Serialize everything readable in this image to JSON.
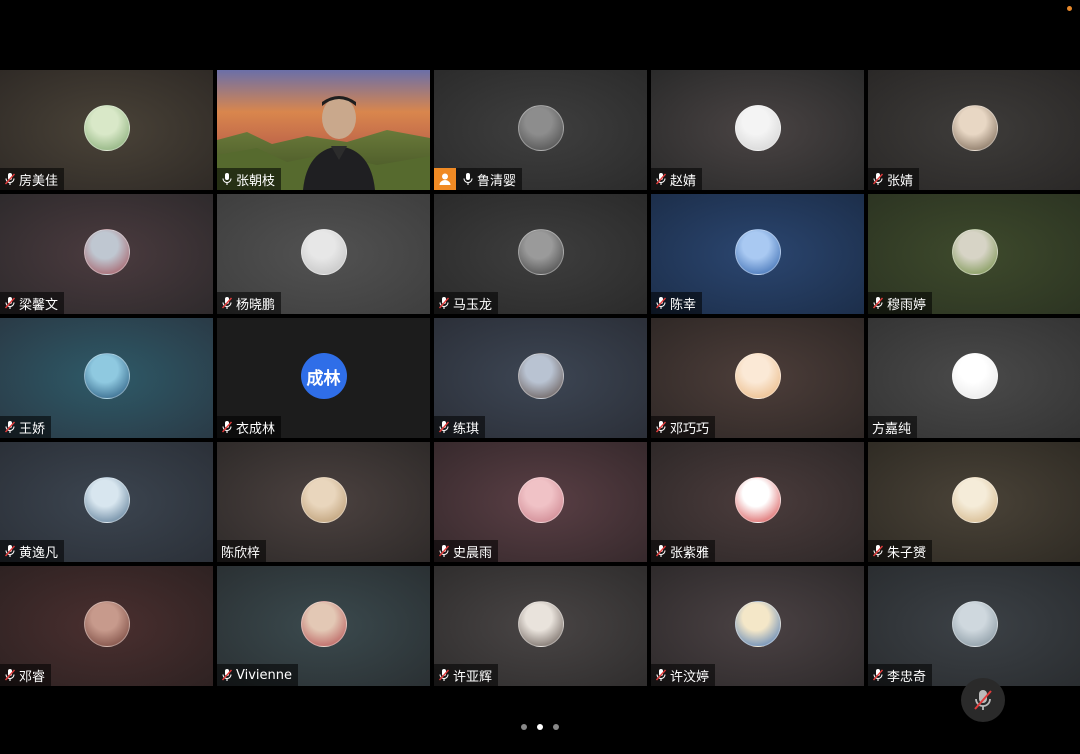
{
  "participants": [
    {
      "name": "房美佳",
      "mic": "muted",
      "bg": [
        "#4a4338",
        "#2f2a26"
      ],
      "avatar": [
        "#d9e8c8",
        "#7aa36a"
      ],
      "kind": "img"
    },
    {
      "name": "张朝枝",
      "mic": "on",
      "kind": "video"
    },
    {
      "name": "鲁清婴",
      "mic": "on",
      "host": true,
      "bg": [
        "#3f3f3f",
        "#2b2b2b"
      ],
      "avatar": [
        "#8d8d8d",
        "#444"
      ],
      "kind": "img"
    },
    {
      "name": "赵婧",
      "mic": "muted",
      "bg": [
        "#4a4444",
        "#2a2a2a"
      ],
      "avatar": [
        "#f4f4f4",
        "#cfcfcf"
      ],
      "kind": "img"
    },
    {
      "name": "张婧",
      "mic": "muted",
      "bg": [
        "#3e3c3a",
        "#2a2827"
      ],
      "avatar": [
        "#e8d7c4",
        "#6d5a48"
      ],
      "kind": "img"
    },
    {
      "name": "梁馨文",
      "mic": "muted",
      "bg": [
        "#4b3b3f",
        "#2e2a2c"
      ],
      "avatar": [
        "#bfc7d1",
        "#a04a52"
      ],
      "kind": "img"
    },
    {
      "name": "杨晓鹏",
      "mic": "muted",
      "bg": [
        "#525252",
        "#3e3e3e"
      ],
      "avatar": [
        "#e7e7e7",
        "#bdbdbd"
      ],
      "kind": "img"
    },
    {
      "name": "马玉龙",
      "mic": "muted",
      "bg": [
        "#3e3e3e",
        "#2a2a2a"
      ],
      "avatar": [
        "#9a9a9a",
        "#3d3d3d"
      ],
      "kind": "img"
    },
    {
      "name": "陈幸",
      "mic": "muted",
      "bg": [
        "#2b4670",
        "#1c2e4a"
      ],
      "avatar": [
        "#a9c9f2",
        "#2a5ea8"
      ],
      "kind": "img"
    },
    {
      "name": "穆雨婷",
      "mic": "muted",
      "bg": [
        "#3e4a2c",
        "#2c3422"
      ],
      "avatar": [
        "#d7d4c6",
        "#6b8a3c"
      ],
      "kind": "img"
    },
    {
      "name": "王娇",
      "mic": "muted",
      "bg": [
        "#2e5a68",
        "#2a3a46"
      ],
      "avatar": [
        "#8fc9e0",
        "#1d4e74"
      ],
      "kind": "img"
    },
    {
      "name": "衣成林",
      "mic": "muted",
      "bg": [
        "#1c1c1c",
        "#1c1c1c"
      ],
      "avatar_text": "成林",
      "kind": "text"
    },
    {
      "name": "练琪",
      "mic": "muted",
      "bg": [
        "#3d4654",
        "#2b2f38"
      ],
      "avatar": [
        "#b9c3d2",
        "#5a4a44"
      ],
      "kind": "img"
    },
    {
      "name": "邓巧巧",
      "mic": "muted",
      "bg": [
        "#4d3e3a",
        "#2f2826"
      ],
      "avatar": [
        "#fbe9d6",
        "#e7b27a"
      ],
      "kind": "img"
    },
    {
      "name": "方嘉纯",
      "mic": "none",
      "bg": [
        "#4a4a4a",
        "#343434"
      ],
      "avatar": [
        "#ffffff",
        "#e4e4e4"
      ],
      "kind": "img"
    },
    {
      "name": "黄逸凡",
      "mic": "muted",
      "bg": [
        "#3c4550",
        "#2b3038"
      ],
      "avatar": [
        "#d8e6ef",
        "#4b6d8a"
      ],
      "kind": "img"
    },
    {
      "name": "陈欣梓",
      "mic": "none",
      "bg": [
        "#4c4240",
        "#2e2a29"
      ],
      "avatar": [
        "#e9d6bd",
        "#b49368"
      ],
      "kind": "img"
    },
    {
      "name": "史晨雨",
      "mic": "muted",
      "bg": [
        "#5a3f45",
        "#36292c"
      ],
      "avatar": [
        "#f0c2c6",
        "#c77b86"
      ],
      "kind": "img"
    },
    {
      "name": "张紫雅",
      "mic": "muted",
      "bg": [
        "#4b3c3c",
        "#2e2828"
      ],
      "avatar": [
        "#ffffff",
        "#d23b3b"
      ],
      "kind": "img"
    },
    {
      "name": "朱子赟",
      "mic": "muted",
      "bg": [
        "#4a4338",
        "#2f2b24"
      ],
      "avatar": [
        "#f5ecd9",
        "#cfae7d"
      ],
      "kind": "img"
    },
    {
      "name": "邓睿",
      "mic": "muted",
      "bg": [
        "#4a2f2f",
        "#2e2222"
      ],
      "avatar": [
        "#c79a8c",
        "#6b3a32"
      ],
      "kind": "img"
    },
    {
      "name": "Vivienne",
      "mic": "muted",
      "bg": [
        "#3b4a4e",
        "#2a3033"
      ],
      "avatar": [
        "#e3c8b5",
        "#b0474a"
      ],
      "kind": "img"
    },
    {
      "name": "许亚辉",
      "mic": "muted",
      "bg": [
        "#494545",
        "#2f2d2d"
      ],
      "avatar": [
        "#e9e3dc",
        "#5a4e48"
      ],
      "kind": "img"
    },
    {
      "name": "许汶婷",
      "mic": "muted",
      "bg": [
        "#4b4244",
        "#2e2a2b"
      ],
      "avatar": [
        "#f4e7c8",
        "#3d6fb3"
      ],
      "kind": "img"
    },
    {
      "name": "李忠奇",
      "mic": "muted",
      "bg": [
        "#3c4146",
        "#2a2d30"
      ],
      "avatar": [
        "#cfd8de",
        "#7a8b96"
      ],
      "kind": "img"
    }
  ],
  "colors": {
    "muted_red": "#e23b3b",
    "host_orange": "#f08a24",
    "text_avatar_blue": "#2f6ee8"
  },
  "self_mic": {
    "icon": "muted-mic-icon"
  },
  "pager": {
    "pages": 3,
    "active": 2
  }
}
